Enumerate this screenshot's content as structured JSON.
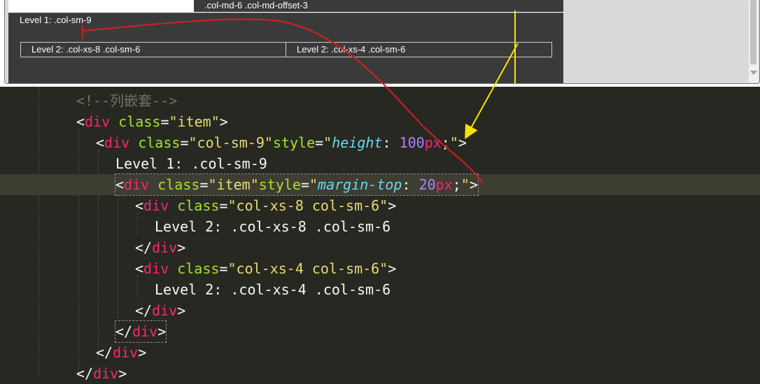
{
  "preview": {
    "offset_cell_text": ".col-md-6 .col-md-offset-3",
    "level1_label": "Level 1: .col-sm-9",
    "level2_cells": [
      "Level 2: .col-xs-8 .col-sm-6",
      "Level 2: .col-xs-4 .col-sm-6"
    ]
  },
  "editor": {
    "lines": [
      {
        "parts": [
          [
            "c-comment",
            "<!--列嵌套-->"
          ]
        ]
      },
      {
        "parts": [
          [
            "c-plain",
            "<"
          ],
          [
            "c-tag",
            "div"
          ],
          [
            "c-plain",
            " "
          ],
          [
            "c-attr",
            "class"
          ],
          [
            "c-plain",
            "="
          ],
          [
            "c-str",
            "\"item\""
          ],
          [
            "c-plain",
            ">"
          ]
        ]
      },
      {
        "parts": [
          [
            "c-plain",
            "<"
          ],
          [
            "c-tag",
            "div"
          ],
          [
            "c-plain",
            " "
          ],
          [
            "c-attr",
            "class"
          ],
          [
            "c-plain",
            "="
          ],
          [
            "c-str",
            "\"col-sm-9\""
          ],
          [
            "c-attr",
            "style"
          ],
          [
            "c-plain",
            "="
          ],
          [
            "c-str",
            "\""
          ],
          [
            "c-prop",
            "height"
          ],
          [
            "c-plain",
            ": "
          ],
          [
            "c-num",
            "100"
          ],
          [
            "c-unit",
            "px"
          ],
          [
            "c-plain",
            ";"
          ],
          [
            "c-str",
            "\""
          ],
          [
            "c-plain",
            ">"
          ]
        ]
      },
      {
        "parts": [
          [
            "c-plain",
            "Level 1: .col-sm-9"
          ]
        ]
      },
      {
        "parts": [
          [
            "c-plain",
            "<"
          ],
          [
            "c-tag",
            "div"
          ],
          [
            "c-plain",
            " "
          ],
          [
            "c-attr",
            "class"
          ],
          [
            "c-plain",
            "="
          ],
          [
            "c-str",
            "\"item\""
          ],
          [
            "c-attr",
            "style"
          ],
          [
            "c-plain",
            "="
          ],
          [
            "c-str",
            "\""
          ],
          [
            "c-prop",
            "margin-top"
          ],
          [
            "c-plain",
            ": "
          ],
          [
            "c-num",
            "20"
          ],
          [
            "c-unit",
            "px"
          ],
          [
            "c-plain",
            ";"
          ],
          [
            "c-str",
            "\""
          ],
          [
            "c-plain",
            ">"
          ]
        ]
      },
      {
        "parts": [
          [
            "c-plain",
            "<"
          ],
          [
            "c-tag",
            "div"
          ],
          [
            "c-plain",
            " "
          ],
          [
            "c-attr",
            "class"
          ],
          [
            "c-plain",
            "="
          ],
          [
            "c-str",
            "\"col-xs-8 col-sm-6\""
          ],
          [
            "c-plain",
            ">"
          ]
        ]
      },
      {
        "parts": [
          [
            "c-plain",
            "Level 2: .col-xs-8 .col-sm-6"
          ]
        ]
      },
      {
        "parts": [
          [
            "c-plain",
            "</"
          ],
          [
            "c-tag",
            "div"
          ],
          [
            "c-plain",
            ">"
          ]
        ]
      },
      {
        "parts": [
          [
            "c-plain",
            "<"
          ],
          [
            "c-tag",
            "div"
          ],
          [
            "c-plain",
            " "
          ],
          [
            "c-attr",
            "class"
          ],
          [
            "c-plain",
            "="
          ],
          [
            "c-str",
            "\"col-xs-4 col-sm-6\""
          ],
          [
            "c-plain",
            ">"
          ]
        ]
      },
      {
        "parts": [
          [
            "c-plain",
            "Level 2: .col-xs-4 .col-sm-6"
          ]
        ]
      },
      {
        "parts": [
          [
            "c-plain",
            "</"
          ],
          [
            "c-tag",
            "div"
          ],
          [
            "c-plain",
            ">"
          ]
        ]
      },
      {
        "parts": [
          [
            "c-plain",
            "</"
          ],
          [
            "c-tag",
            "div"
          ],
          [
            "c-plain",
            ">"
          ]
        ]
      },
      {
        "parts": [
          [
            "c-plain",
            "</"
          ],
          [
            "c-tag",
            "div"
          ],
          [
            "c-plain",
            ">"
          ]
        ]
      },
      {
        "parts": [
          [
            "c-plain",
            "</"
          ],
          [
            "c-tag",
            "div"
          ],
          [
            "c-plain",
            ">"
          ]
        ]
      }
    ]
  },
  "annotation_colors": {
    "red_arrow": "#d42020",
    "yellow_arrow": "#f5e400"
  }
}
